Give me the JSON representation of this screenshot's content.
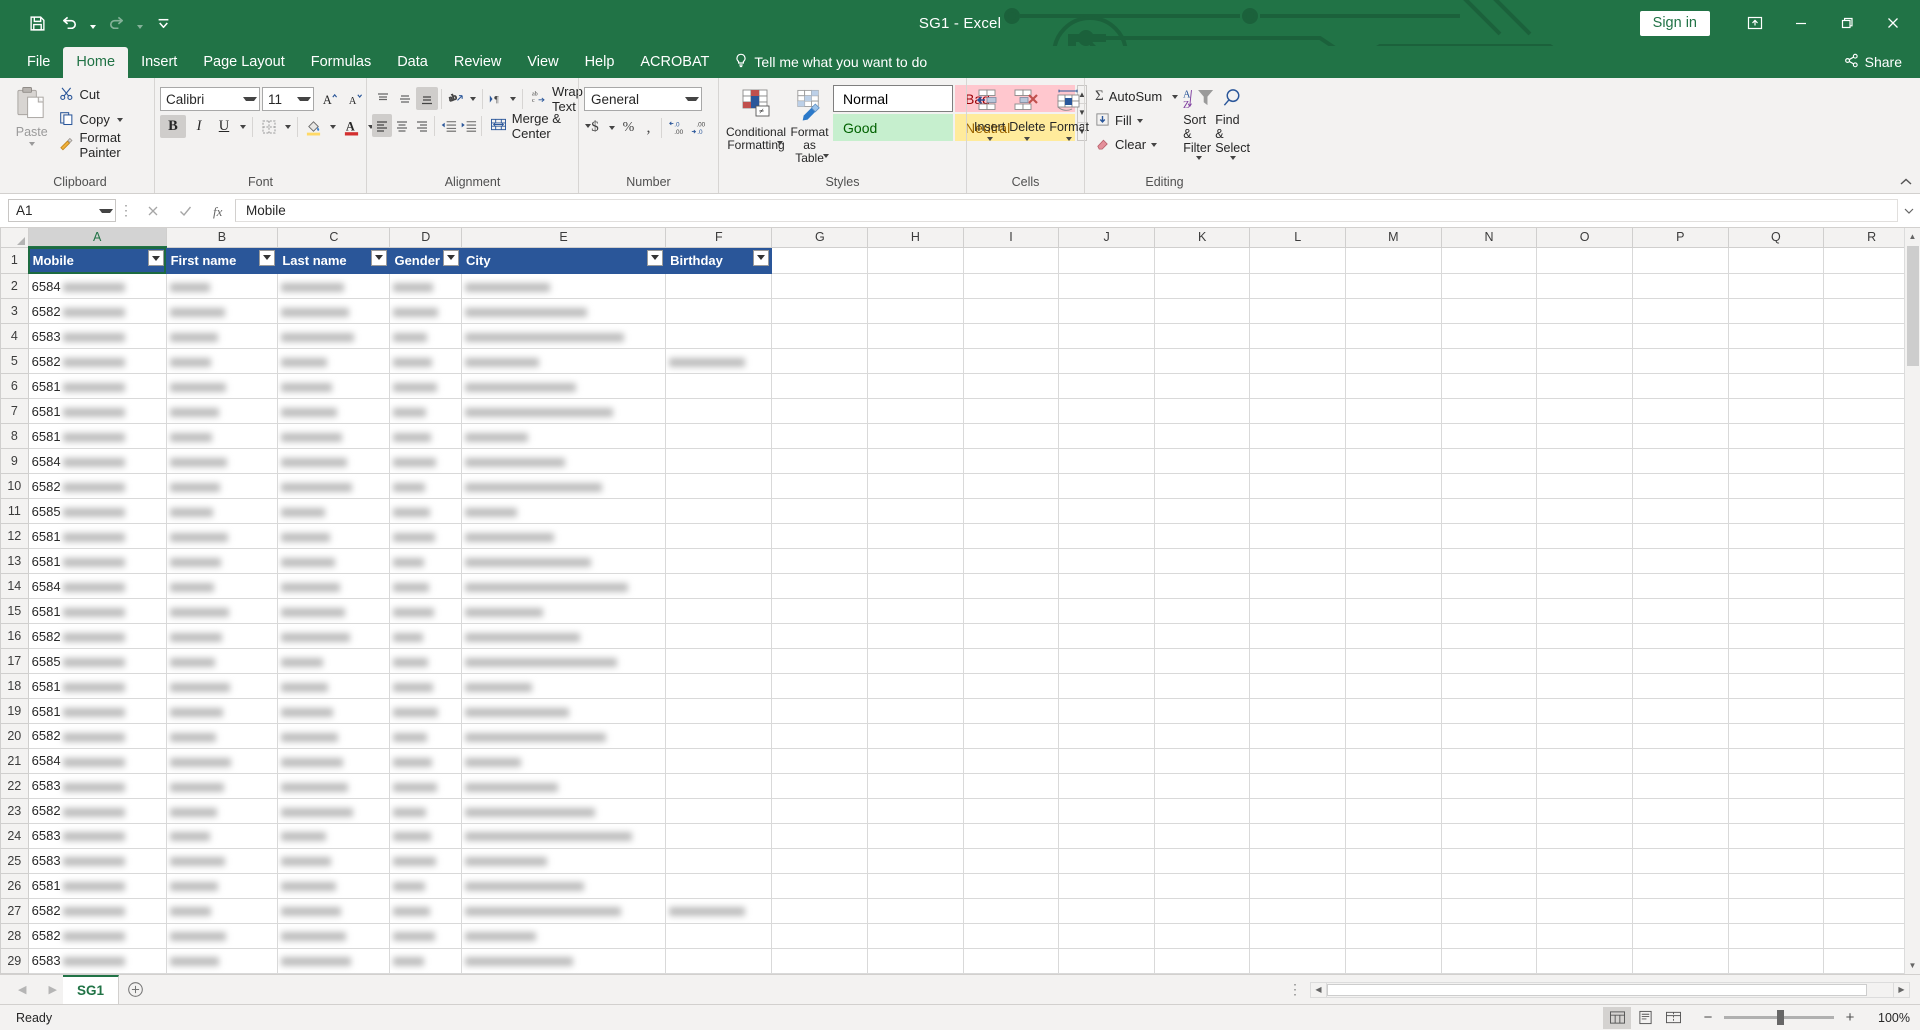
{
  "window": {
    "title": "SG1  -  Excel",
    "signin_label": "Sign in",
    "ribbon_display_icon": "ribbon-display-options-icon",
    "minimize_icon": "minimize-icon",
    "restore_icon": "restore-icon",
    "close_icon": "close-icon"
  },
  "qat": {
    "save": "save-icon",
    "undo": "undo-icon",
    "redo": "redo-icon",
    "customize": "customize-qat-icon"
  },
  "tabs": {
    "items": [
      {
        "label": "File",
        "active": false
      },
      {
        "label": "Home",
        "active": true
      },
      {
        "label": "Insert",
        "active": false
      },
      {
        "label": "Page Layout",
        "active": false
      },
      {
        "label": "Formulas",
        "active": false
      },
      {
        "label": "Data",
        "active": false
      },
      {
        "label": "Review",
        "active": false
      },
      {
        "label": "View",
        "active": false
      },
      {
        "label": "Help",
        "active": false
      },
      {
        "label": "ACROBAT",
        "active": false
      }
    ],
    "tellme": "Tell me what you want to do",
    "share": "Share"
  },
  "ribbon": {
    "clipboard": {
      "label": "Clipboard",
      "paste": "Paste",
      "cut": "Cut",
      "copy": "Copy",
      "format_painter": "Format Painter"
    },
    "font": {
      "label": "Font",
      "font_name": "Calibri",
      "font_size": "11",
      "grow_font": "A",
      "shrink_font": "A",
      "bold": "B",
      "italic": "I",
      "underline": "U"
    },
    "alignment": {
      "label": "Alignment",
      "wrap_text": "Wrap Text",
      "merge_center": "Merge & Center"
    },
    "number": {
      "label": "Number",
      "format": "General",
      "currency": "$",
      "percent": "%",
      "comma": ","
    },
    "styles": {
      "label": "Styles",
      "conditional_formatting": "Conditional Formatting",
      "format_as_table": "Format as Table",
      "gallery": [
        {
          "name": "Normal",
          "bg": "#ffffff",
          "fg": "#000000",
          "border": "#7f7f7f"
        },
        {
          "name": "Bad",
          "bg": "#ffc7ce",
          "fg": "#9c0006",
          "border": "transparent"
        },
        {
          "name": "Good",
          "bg": "#c6efce",
          "fg": "#006100",
          "border": "transparent"
        },
        {
          "name": "Neutral",
          "bg": "#ffeb9c",
          "fg": "#9c6500",
          "border": "transparent"
        }
      ]
    },
    "cells": {
      "label": "Cells",
      "insert": "Insert",
      "delete": "Delete",
      "format": "Format"
    },
    "editing": {
      "label": "Editing",
      "autosum": "AutoSum",
      "fill": "Fill",
      "clear": "Clear",
      "sort_filter": "Sort & Filter",
      "find_select": "Find & Select"
    }
  },
  "formula_bar": {
    "name_box": "A1",
    "cancel_icon": "cancel-icon",
    "enter_icon": "enter-icon",
    "function_icon": "insert-function-icon",
    "value": "Mobile",
    "expand_icon": "expand-formula-bar-icon"
  },
  "grid": {
    "columns": [
      "A",
      "B",
      "C",
      "D",
      "E",
      "F",
      "G",
      "H",
      "I",
      "J",
      "K",
      "L",
      "M",
      "N",
      "O",
      "P",
      "Q",
      "R"
    ],
    "selected_column": "A",
    "selected_cell": "A1",
    "table_headers": [
      "Mobile",
      "First name",
      "Last name",
      "Gender",
      "City",
      "Birthday"
    ],
    "header_bg": "#2a5699",
    "header_fg": "#ffffff",
    "rows": [
      {
        "n": "2",
        "mobile": "6584",
        "redacted": true
      },
      {
        "n": "3",
        "mobile": "6582",
        "redacted": true
      },
      {
        "n": "4",
        "mobile": "6583",
        "redacted": true
      },
      {
        "n": "5",
        "mobile": "6582",
        "redacted": true
      },
      {
        "n": "6",
        "mobile": "6581",
        "redacted": true
      },
      {
        "n": "7",
        "mobile": "6581",
        "redacted": true
      },
      {
        "n": "8",
        "mobile": "6581",
        "redacted": true
      },
      {
        "n": "9",
        "mobile": "6584",
        "redacted": true
      },
      {
        "n": "10",
        "mobile": "6582",
        "redacted": true
      },
      {
        "n": "11",
        "mobile": "6585",
        "redacted": true
      },
      {
        "n": "12",
        "mobile": "6581",
        "redacted": true
      },
      {
        "n": "13",
        "mobile": "6581",
        "redacted": true
      },
      {
        "n": "14",
        "mobile": "6584",
        "redacted": true
      },
      {
        "n": "15",
        "mobile": "6581",
        "redacted": true
      },
      {
        "n": "16",
        "mobile": "6582",
        "redacted": true
      },
      {
        "n": "17",
        "mobile": "6585",
        "redacted": true
      },
      {
        "n": "18",
        "mobile": "6581",
        "redacted": true
      },
      {
        "n": "19",
        "mobile": "6581",
        "redacted": true
      },
      {
        "n": "20",
        "mobile": "6582",
        "redacted": true
      },
      {
        "n": "21",
        "mobile": "6584",
        "redacted": true
      },
      {
        "n": "22",
        "mobile": "6583",
        "redacted": true
      },
      {
        "n": "23",
        "mobile": "6582",
        "redacted": true
      },
      {
        "n": "24",
        "mobile": "6583",
        "redacted": true
      },
      {
        "n": "25",
        "mobile": "6583",
        "redacted": true
      },
      {
        "n": "26",
        "mobile": "6581",
        "redacted": true
      },
      {
        "n": "27",
        "mobile": "6582",
        "redacted": true
      },
      {
        "n": "28",
        "mobile": "6582",
        "redacted": true
      },
      {
        "n": "29",
        "mobile": "6583",
        "redacted": true
      }
    ]
  },
  "sheets": {
    "tabs": [
      {
        "label": "SG1",
        "active": true
      }
    ],
    "add_label": "+"
  },
  "status": {
    "text": "Ready",
    "views": [
      {
        "name": "normal-view",
        "active": true
      },
      {
        "name": "page-layout-view",
        "active": false
      },
      {
        "name": "page-break-preview",
        "active": false
      }
    ],
    "zoom": "100%"
  }
}
